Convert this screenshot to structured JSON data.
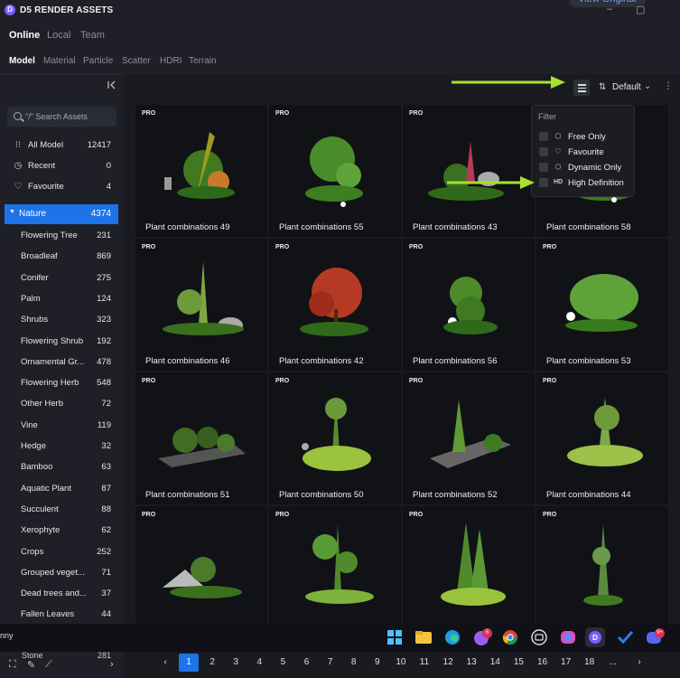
{
  "app": {
    "title": "D5 RENDER ASSETS",
    "logo": "D",
    "view_original": "View Original"
  },
  "header": {
    "source_tabs": [
      "Online",
      "Local",
      "Team"
    ],
    "category_tabs": [
      "Model",
      "Material",
      "Particle",
      "Scatter",
      "HDRI",
      "Terrain"
    ]
  },
  "sidebar": {
    "search_placeholder": "\"/\" Search Assets",
    "top_items": [
      {
        "label": "All Model",
        "count": "12417",
        "icon": "grid-icon"
      },
      {
        "label": "Recent",
        "count": "0",
        "icon": "clock-icon"
      },
      {
        "label": "Favourite",
        "count": "4",
        "icon": "heart-icon"
      }
    ],
    "category": {
      "label": "Nature",
      "count": "4374"
    },
    "subcategories": [
      {
        "label": "Flowering Tree",
        "count": "231"
      },
      {
        "label": "Broadleaf",
        "count": "869"
      },
      {
        "label": "Conifer",
        "count": "275"
      },
      {
        "label": "Palm",
        "count": "124"
      },
      {
        "label": "Shrubs",
        "count": "323"
      },
      {
        "label": "Flowering Shrub",
        "count": "192"
      },
      {
        "label": "Ornamental Gr...",
        "count": "478"
      },
      {
        "label": "Flowering Herb",
        "count": "548"
      },
      {
        "label": "Other Herb",
        "count": "72"
      },
      {
        "label": "Vine",
        "count": "119"
      },
      {
        "label": "Hedge",
        "count": "32"
      },
      {
        "label": "Bamboo",
        "count": "63"
      },
      {
        "label": "Aquatic Plant",
        "count": "87"
      },
      {
        "label": "Succulent",
        "count": "88"
      },
      {
        "label": "Xerophyte",
        "count": "62"
      },
      {
        "label": "Crops",
        "count": "252"
      },
      {
        "label": "Grouped veget...",
        "count": "71"
      },
      {
        "label": "Dead trees and...",
        "count": "37"
      },
      {
        "label": "Fallen Leaves",
        "count": "44"
      }
    ],
    "stone": {
      "label": "Stone",
      "count": "281"
    }
  },
  "toolbar": {
    "sort_label": "Default"
  },
  "filter": {
    "title": "Filter",
    "options": [
      {
        "label": "Free Only",
        "icon": "cube-icon"
      },
      {
        "label": "Favourite",
        "icon": "heart-icon"
      },
      {
        "label": "Dynamic Only",
        "icon": "dynamic-cube-icon"
      },
      {
        "label": "High Definition",
        "icon": "HD"
      }
    ]
  },
  "assets": [
    {
      "name": "Plant combinations 49",
      "badge": "PRO"
    },
    {
      "name": "Plant combinations 55",
      "badge": "PRO"
    },
    {
      "name": "Plant combinations 43",
      "badge": "PRO"
    },
    {
      "name": "Plant combinations 58",
      "badge": "PRO"
    },
    {
      "name": "Plant combinations 46",
      "badge": "PRO"
    },
    {
      "name": "Plant combinations 42",
      "badge": "PRO"
    },
    {
      "name": "Plant combinations 56",
      "badge": "PRO"
    },
    {
      "name": "Plant combinations 53",
      "badge": "PRO"
    },
    {
      "name": "Plant combinations 51",
      "badge": "PRO"
    },
    {
      "name": "Plant combinations 50",
      "badge": "PRO"
    },
    {
      "name": "Plant combinations 52",
      "badge": "PRO"
    },
    {
      "name": "Plant combinations 44",
      "badge": "PRO"
    },
    {
      "name": "",
      "badge": "PRO"
    },
    {
      "name": "",
      "badge": "PRO"
    },
    {
      "name": "",
      "badge": "PRO"
    },
    {
      "name": "",
      "badge": "PRO"
    }
  ],
  "taskbar": {
    "partial_text": "nny",
    "badges": {
      "messenger": "6",
      "discord": "9+"
    }
  },
  "pagination": {
    "pages": [
      "1",
      "2",
      "3",
      "4",
      "5",
      "6",
      "7",
      "8",
      "9",
      "10",
      "11",
      "12",
      "13",
      "14",
      "15",
      "16",
      "17",
      "18",
      "..."
    ],
    "current": "1"
  },
  "colors": {
    "accent": "#1c74e8",
    "annotation_arrow": "#a6e22e",
    "brand": "#7c5cff"
  }
}
